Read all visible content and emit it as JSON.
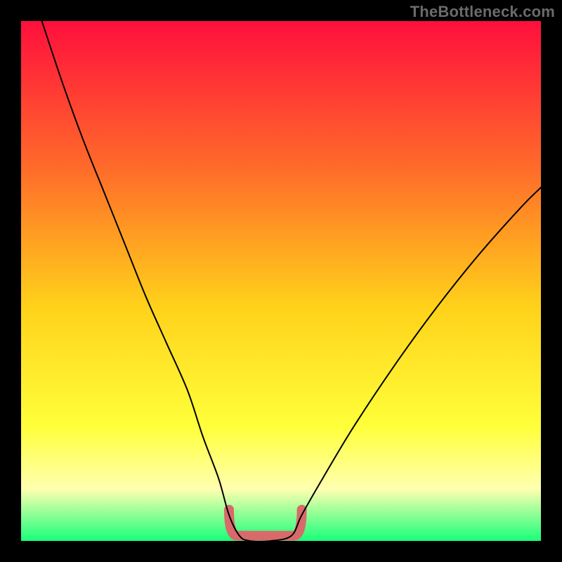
{
  "watermark": "TheBottleneck.com",
  "colors": {
    "frame": "#000000",
    "gradient_top": "#ff0f3c",
    "gradient_upper_mid": "#ff6a2a",
    "gradient_mid": "#ffd21a",
    "gradient_lower_mid": "#ffff3a",
    "gradient_pale_band": "#ffffb0",
    "gradient_bottom": "#18ff7a",
    "curve": "#000000",
    "valley_mark": "#d86a6a"
  },
  "chart_data": {
    "type": "line",
    "title": "",
    "xlabel": "",
    "ylabel": "",
    "xlim": [
      0,
      100
    ],
    "ylim": [
      0,
      100
    ],
    "grid": false,
    "series": [
      {
        "name": "bottleneck-curve",
        "x": [
          4,
          8,
          12,
          16,
          20,
          24,
          28,
          32,
          35,
          38,
          40,
          42,
          44,
          48,
          52,
          54,
          58,
          64,
          72,
          80,
          88,
          96,
          100
        ],
        "y": [
          100,
          88,
          77,
          67,
          57,
          47,
          38,
          29,
          20,
          12,
          5,
          1,
          0,
          0,
          1,
          5,
          12,
          22,
          34,
          45,
          55,
          64,
          68
        ]
      }
    ],
    "valley_floor": {
      "x_start": 40,
      "x_end": 54,
      "y_floor": 1
    }
  }
}
